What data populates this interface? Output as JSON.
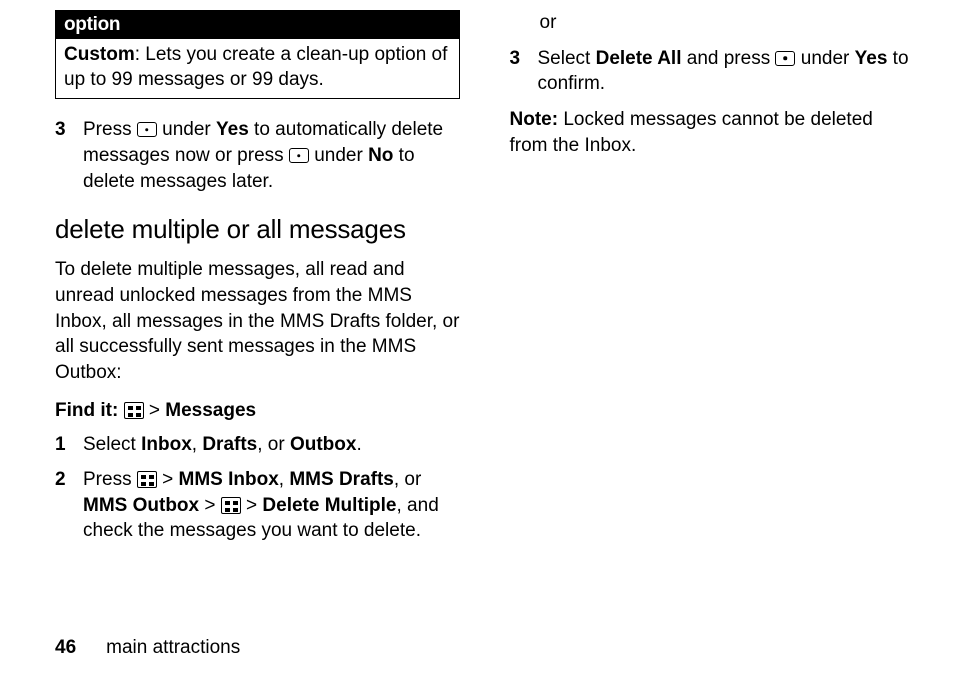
{
  "option": {
    "header": "option",
    "body_prefix_bold": "Custom",
    "body_rest": ": Lets you create a clean-up option of up to 99 messages or 99 days."
  },
  "left": {
    "step3": {
      "num": "3",
      "t1": "Press ",
      "t2": " under ",
      "yes": "Yes",
      "t3": " to automatically delete messages now or press ",
      "t4": " under ",
      "no": "No",
      "t5": " to delete messages later."
    },
    "heading": "delete multiple or all messages",
    "intro": "To delete multiple messages, all read and unread unlocked messages from the MMS Inbox, all messages in the MMS Drafts folder, or all successfully sent messages in the MMS Outbox:",
    "findit_label": "Find it:",
    "findit_gt": " > ",
    "findit_messages": "Messages",
    "step1": {
      "num": "1",
      "t1": "Select ",
      "inbox": "Inbox",
      "c1": ", ",
      "drafts": "Drafts",
      "c2": ", or ",
      "outbox": "Outbox",
      "dot": "."
    },
    "step2": {
      "num": "2",
      "t1": "Press ",
      "gt1": " > ",
      "mmsinbox": "MMS Inbox",
      "c1": ", ",
      "mmsdrafts": "MMS Drafts",
      "c2": ", or ",
      "mmsoutbox": "MMS Outbox",
      "gt2": " > ",
      "gt3": " > ",
      "delmult": "Delete Multiple",
      "t2": ", and check the messages you want to delete."
    }
  },
  "right": {
    "or": "or",
    "step3b": {
      "num": "3",
      "t1": "Select ",
      "delall": "Delete All",
      "t2": " and press ",
      "t3": " under ",
      "yes": "Yes",
      "t4": " to confirm."
    },
    "note_label": "Note:",
    "note_body": " Locked messages cannot be deleted from the Inbox."
  },
  "footer": {
    "page": "46",
    "section": "main attractions"
  }
}
